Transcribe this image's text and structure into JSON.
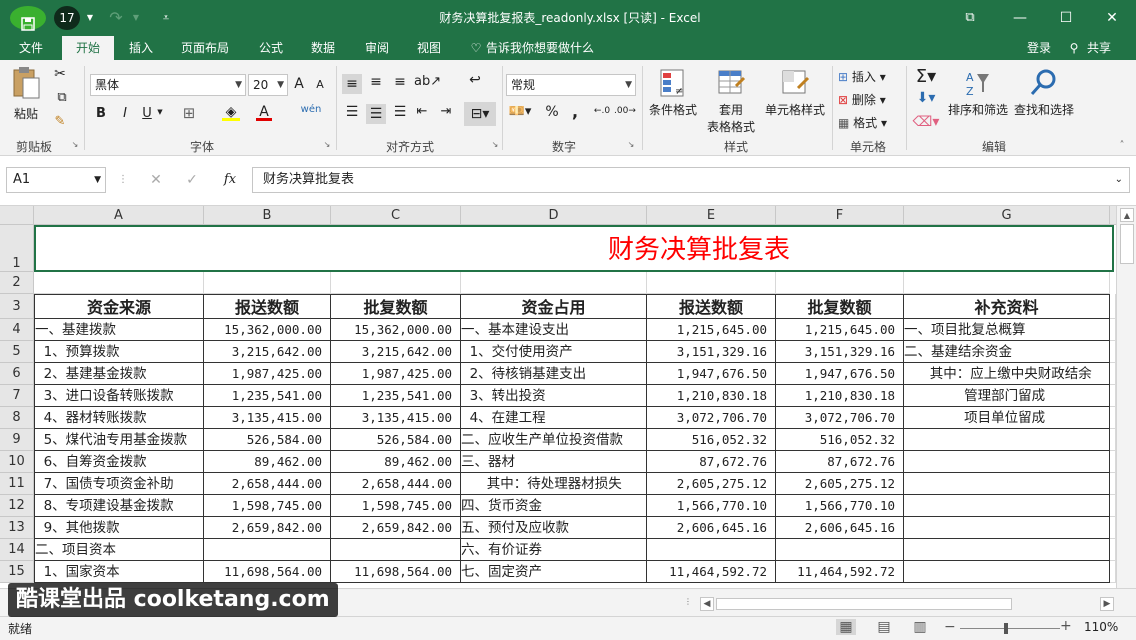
{
  "app": {
    "title": "财务决算批复报表_readonly.xlsx  [只读] - Excel",
    "undo_count": "17",
    "accent": "#217346",
    "titlebar_buttons": [
      "⧉",
      "—",
      "☐",
      "✕"
    ]
  },
  "menu": {
    "items": [
      "文件",
      "开始",
      "插入",
      "页面布局",
      "公式",
      "数据",
      "审阅",
      "视图"
    ],
    "active": "开始",
    "tell_me": "告诉我你想要做什么",
    "login": "登录",
    "share": "共享"
  },
  "ribbon": {
    "clipboard": {
      "paste": "粘贴",
      "label": "剪贴板"
    },
    "font": {
      "name": "黑体",
      "size": "20",
      "label": "字体",
      "bold": "B",
      "italic": "I",
      "underline": "U",
      "grow": "A",
      "shrink": "A",
      "pinyin": "wén",
      "font_color": "A"
    },
    "alignment": {
      "label": "对齐方式"
    },
    "number": {
      "format": "常规",
      "label": "数字",
      "percent": "%",
      "comma": ","
    },
    "styles": {
      "conditional": "条件格式",
      "table1": "套用",
      "table2": "表格格式",
      "cell_style": "单元格样式",
      "label": "样式"
    },
    "cells": {
      "insert": "插入",
      "delete": "删除",
      "format": "格式",
      "label": "单元格"
    },
    "editing": {
      "sort": "排序和筛选",
      "find": "查找和选择",
      "label": "编辑"
    }
  },
  "formula_bar": {
    "name_box": "A1",
    "content": "财务决算批复表",
    "fx": "fx"
  },
  "sheet": {
    "columns": [
      "A",
      "B",
      "C",
      "D",
      "E",
      "F",
      "G"
    ],
    "rows": [
      "1",
      "2",
      "3",
      "4",
      "5",
      "6",
      "7",
      "8",
      "9",
      "10",
      "11",
      "12",
      "13",
      "14",
      "15"
    ],
    "title": "财务决算批复表",
    "title_color": "#ff0000",
    "headers": [
      "资金来源",
      "报送数额",
      "批复数额",
      "资金占用",
      "报送数额",
      "批复数额",
      "补充资料"
    ],
    "data": [
      [
        "一、基建拨款",
        "15,362,000.00",
        "15,362,000.00",
        "一、基本建设支出",
        "1,215,645.00",
        "1,215,645.00",
        "一、项目批复总概算"
      ],
      [
        "  1、预算拨款",
        "3,215,642.00",
        "3,215,642.00",
        "  1、交付使用资产",
        "3,151,329.16",
        "3,151,329.16",
        "二、基建结余资金"
      ],
      [
        "  2、基建基金拨款",
        "1,987,425.00",
        "1,987,425.00",
        "  2、待核销基建支出",
        "1,947,676.50",
        "1,947,676.50",
        "      其中：应上缴中央财政结余"
      ],
      [
        "  3、进口设备转账拨款",
        "1,235,541.00",
        "1,235,541.00",
        "  3、转出投资",
        "1,210,830.18",
        "1,210,830.18",
        "              管理部门留成"
      ],
      [
        "  4、器材转账拨款",
        "3,135,415.00",
        "3,135,415.00",
        "  4、在建工程",
        "3,072,706.70",
        "3,072,706.70",
        "              项目单位留成"
      ],
      [
        "  5、煤代油专用基金拨款",
        "526,584.00",
        "526,584.00",
        "二、应收生产单位投资借款",
        "516,052.32",
        "516,052.32",
        ""
      ],
      [
        "  6、自筹资金拨款",
        "89,462.00",
        "89,462.00",
        "三、器材",
        "87,672.76",
        "87,672.76",
        ""
      ],
      [
        "  7、国债专项资金补助",
        "2,658,444.00",
        "2,658,444.00",
        "      其中：待处理器材损失",
        "2,605,275.12",
        "2,605,275.12",
        ""
      ],
      [
        "  8、专项建设基金拨款",
        "1,598,745.00",
        "1,598,745.00",
        "四、货币资金",
        "1,566,770.10",
        "1,566,770.10",
        ""
      ],
      [
        "  9、其他拨款",
        "2,659,842.00",
        "2,659,842.00",
        "五、预付及应收款",
        "2,606,645.16",
        "2,606,645.16",
        ""
      ],
      [
        "二、项目资本",
        "",
        "",
        "六、有价证券",
        "",
        "",
        ""
      ],
      [
        "  1、国家资本",
        "11,698,564.00",
        "11,698,564.00",
        "七、固定资产",
        "11,464,592.72",
        "11,464,592.72",
        ""
      ]
    ]
  },
  "status": {
    "ready": "就绪",
    "zoom": "110%"
  },
  "watermark": "酷课堂出品 coolketang.com"
}
